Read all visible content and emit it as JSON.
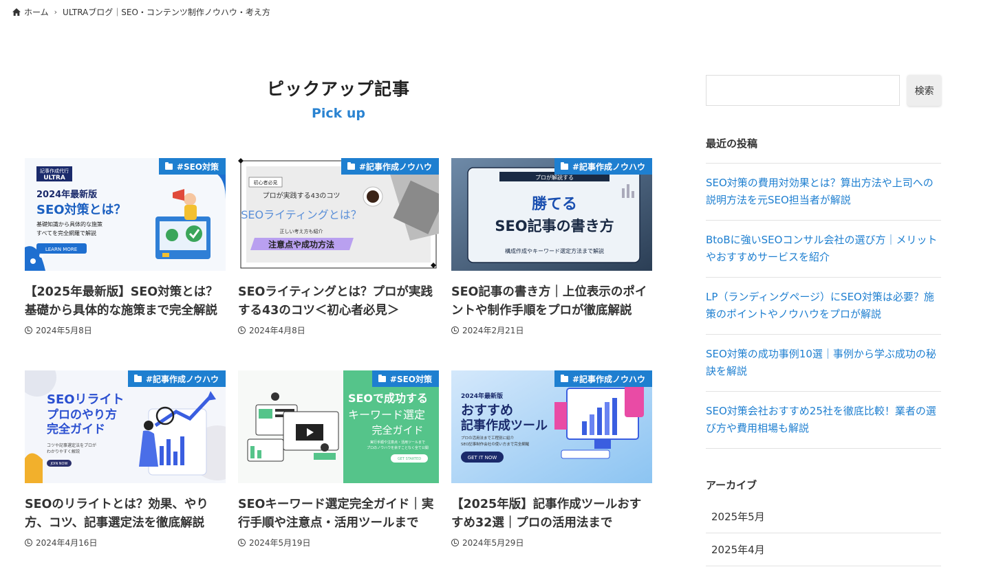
{
  "breadcrumb": {
    "home": "ホーム",
    "current": "ULTRAブログ｜SEO・コンテンツ制作ノウハウ・考え方"
  },
  "pickup": {
    "title": "ピックアップ記事",
    "subtitle": "Pick up"
  },
  "articles": [
    {
      "category": "#SEO対策",
      "title": "【2025年最新版】SEO対策とは？基礎から具体的な施策まで完全解説",
      "date": "2024年5月8日",
      "thumb": {
        "brand": "記事作成代行",
        "brand2": "ULTRA",
        "line1": "2024年最新版",
        "line2": "SEO対策とは？",
        "line3": "基礎知識から具体的な施策",
        "line4": "すべてを完全網羅で解説",
        "button": "LEARN MORE"
      }
    },
    {
      "category": "#記事作成ノウハウ",
      "title": "SEOライティングとは？プロが実践する43のコツ＜初心者必見＞",
      "date": "2024年4月8日",
      "thumb": {
        "badge": "初心者必見",
        "line1": "プロが実践する43のコツ",
        "line2": "SEOライティングとは？",
        "line3": "正しい考え方も紹介",
        "line4": "注意点や成功方法"
      }
    },
    {
      "category": "#記事作成ノウハウ",
      "title": "SEO記事の書き方｜上位表示のポイントや制作手順をプロが徹底解説",
      "date": "2024年2月21日",
      "thumb": {
        "line0": "プロが解説する",
        "line1": "勝てる",
        "line2": "SEO記事の書き方",
        "line3": "構成作成やキーワード選定方法まで解説"
      }
    },
    {
      "category": "#記事作成ノウハウ",
      "title": "SEOのリライトとは？効果、やり方、コツ、記事選定法を徹底解説",
      "date": "2024年4月16日",
      "thumb": {
        "line1": "SEOリライト",
        "line2": "プロのやり方",
        "line3": "完全ガイド",
        "line4": "コツや記事選定法をプロが",
        "line5": "わかりやすく解説",
        "button": "JOIN NOW"
      }
    },
    {
      "category": "#SEO対策",
      "title": "SEOキーワード選定完全ガイド｜実行手順や注意点・活用ツールまで",
      "date": "2024年5月19日",
      "thumb": {
        "line1": "SEOで成功する",
        "line2": "キーワード選定",
        "line3": "完全ガイド",
        "line4": "実行手順や注意点・活用ツールまで",
        "line5": "プロのノウハウを余すことなく全て公開",
        "button": "GET STARTED"
      }
    },
    {
      "category": "#記事作成ノウハウ",
      "title": "【2025年版】記事作成ツールおすすめ32選｜プロの活用法まで",
      "date": "2024年5月29日",
      "thumb": {
        "line1": "2024年最新版",
        "line2": "おすすめ",
        "line3": "記事作成ツール",
        "line4": "プロの活用法まで工程別に紹介",
        "line5": "SEO記事制作会社の使い方まで完全網羅",
        "button": "GET IT NOW"
      }
    }
  ],
  "sidebar": {
    "search_button": "検索",
    "search_value": "",
    "recent_title": "最近の投稿",
    "recent_posts": [
      "SEO対策の費用対効果とは？算出方法や上司への説明方法を元SEO担当者が解説",
      "BtoBに強いSEOコンサル会社の選び方｜メリットやおすすめサービスを紹介",
      "LP（ランディングページ）にSEO対策は必要？施策のポイントやノウハウをプロが解説",
      "SEO対策の成功事例10選｜事例から学ぶ成功の秘訣を解説",
      "SEO対策会社おすすめ25社を徹底比較！業者の選び方や費用相場も解説"
    ],
    "archive_title": "アーカイブ",
    "archives": [
      "2025年5月",
      "2025年4月"
    ]
  },
  "colors": {
    "accent": "#1e7fd0",
    "text": "#333333"
  }
}
